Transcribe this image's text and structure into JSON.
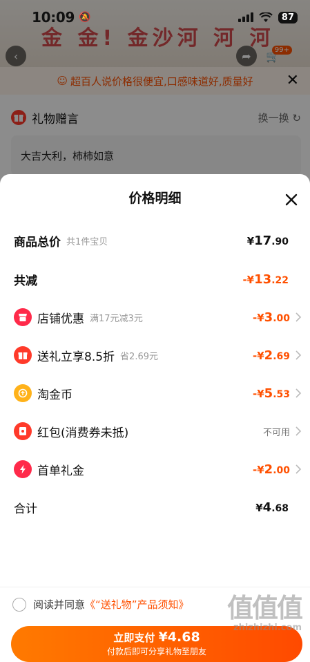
{
  "status_bar": {
    "time": "10:09",
    "battery": "87",
    "mute_icon": "bell-slash-icon",
    "wifi_icon": "wifi-icon"
  },
  "background": {
    "banner_text": "金 金! 金沙河 河 河",
    "cart_badge": "99+",
    "hint": "超百人说价格很便宜,口感味道好,质量好",
    "gift_message": {
      "title": "礼物赠言",
      "refresh": "换一换",
      "text": "大吉大利，柿柿如意"
    }
  },
  "sheet": {
    "title": "价格明细",
    "rows": [
      {
        "label": "商品总价",
        "sub": "共1件宝贝",
        "amount_int": "17",
        "amount_dec": ".90",
        "prefix": "¥",
        "color": "#111111",
        "bold": true
      },
      {
        "label": "共减",
        "sub": "",
        "amount_int": "13",
        "amount_dec": ".22",
        "prefix": "-¥",
        "color": "#ff5000",
        "bold": true
      },
      {
        "label": "店铺优惠",
        "sub": "满17元减3元",
        "amount_int": "3",
        "amount_dec": ".00",
        "prefix": "-¥",
        "color": "#ff5000",
        "icon": "shop-icon",
        "icon_color": "#ff2a4a"
      },
      {
        "label": "送礼立享8.5折",
        "sub": "省2.69元",
        "amount_int": "2",
        "amount_dec": ".69",
        "prefix": "-¥",
        "color": "#ff5000",
        "icon": "gift-icon",
        "icon_color": "#ff3a2a"
      },
      {
        "label": "淘金币",
        "sub": "",
        "amount_int": "5",
        "amount_dec": ".53",
        "prefix": "-¥",
        "color": "#ff5000",
        "icon": "coin-icon",
        "icon_color": "#ffb21a"
      },
      {
        "label": "红包(消费券未抵)",
        "sub": "",
        "unavailable": "不可用",
        "icon": "red-packet-icon",
        "icon_color": "#ff3a2a"
      },
      {
        "label": "首单礼金",
        "sub": "",
        "amount_int": "2",
        "amount_dec": ".00",
        "prefix": "-¥",
        "color": "#ff5000",
        "icon": "lightning-icon",
        "icon_color": "#ff2a4a"
      },
      {
        "label": "合计",
        "sub": "",
        "amount_int": "4",
        "amount_dec": ".68",
        "prefix": "¥",
        "color": "#111111"
      }
    ],
    "agreement_text": "阅读并同意",
    "agreement_link": "《“送礼物”产品须知》",
    "pay_label": "立即支付",
    "pay_amount": "¥4.68",
    "pay_sub": "付款后即可分享礼物至朋友"
  },
  "watermark": {
    "big": "值值值",
    "small": "zhizhizhi.com"
  }
}
